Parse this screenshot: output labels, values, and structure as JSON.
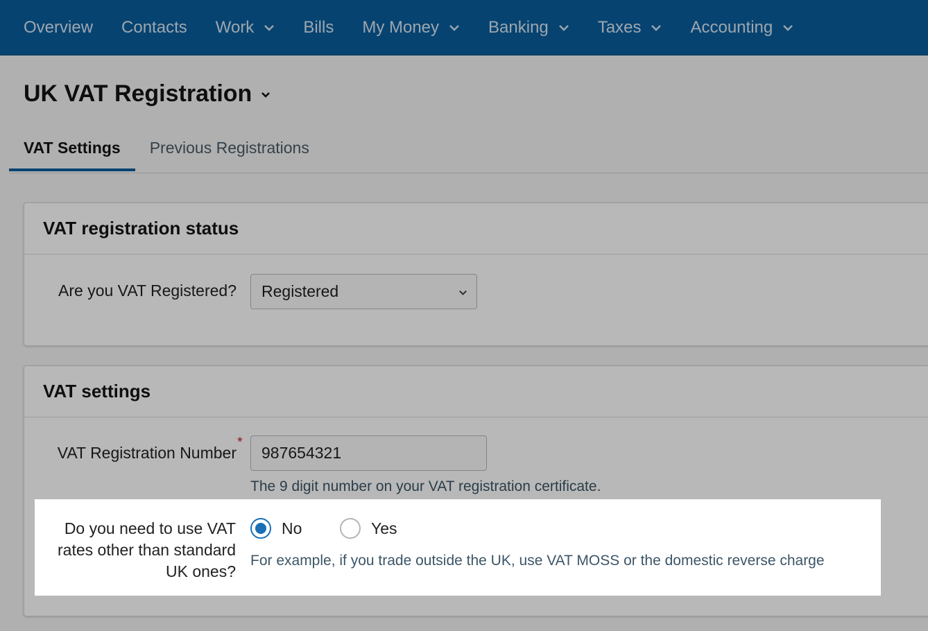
{
  "nav": {
    "items": [
      {
        "label": "Overview",
        "has_dropdown": false
      },
      {
        "label": "Contacts",
        "has_dropdown": false
      },
      {
        "label": "Work",
        "has_dropdown": true
      },
      {
        "label": "Bills",
        "has_dropdown": false
      },
      {
        "label": "My Money",
        "has_dropdown": true
      },
      {
        "label": "Banking",
        "has_dropdown": true
      },
      {
        "label": "Taxes",
        "has_dropdown": true
      },
      {
        "label": "Accounting",
        "has_dropdown": true
      }
    ]
  },
  "page": {
    "title": "UK VAT Registration",
    "tabs": [
      {
        "label": "VAT Settings",
        "active": true
      },
      {
        "label": "Previous Registrations",
        "active": false
      }
    ]
  },
  "status_card": {
    "heading": "VAT registration status",
    "registered_label": "Are you VAT Registered?",
    "registered_value": "Registered"
  },
  "settings_card": {
    "heading": "VAT settings",
    "number_label": "VAT Registration Number",
    "required_mark": "*",
    "number_value": "987654321",
    "number_help": "The 9 digit number on your VAT registration certificate.",
    "rates_label_lines": [
      "Do you need to use VAT",
      "rates other than standard",
      "UK ones?"
    ],
    "rates_options": [
      {
        "label": "No",
        "checked": true
      },
      {
        "label": "Yes",
        "checked": false
      }
    ],
    "rates_help": "For example, if you trade outside the UK, use VAT MOSS or the domestic reverse charge"
  },
  "colors": {
    "nav_bg": "#0a5e9d",
    "accent": "#1a6fb5",
    "required": "#c0282e"
  }
}
